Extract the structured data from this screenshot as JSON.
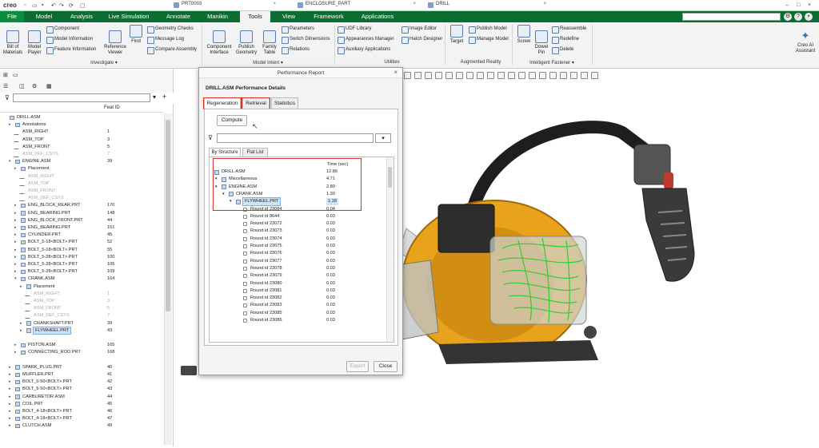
{
  "app": {
    "logo": "creo",
    "window_tabs": [
      "PRT0003",
      "ENCLOSURE_PART",
      "DRILL"
    ]
  },
  "ribbon": {
    "tabs": [
      "File",
      "Model",
      "Analysis",
      "Live Simulation",
      "Annotate",
      "Manikin",
      "Tools",
      "View",
      "Framework",
      "Applications"
    ],
    "active_tab": "Tools",
    "investigate": {
      "bill_of_materials": "Bill of\nMaterials",
      "model_player": "Model\nPlayer",
      "component": "Component",
      "model_information": "Model Information",
      "feature_information": "Feature Information",
      "reference_viewer": "Reference\nViewer",
      "find": "Find",
      "geometry_checks": "Geometry Checks",
      "message_log": "Message Log",
      "compare_assembly": "Compare Assembly",
      "group": "Investigate ▾"
    },
    "model_intent": {
      "component_interface": "Component\nInterface",
      "publish_geometry": "Publish\nGeometry",
      "family_table": "Family\nTable",
      "parameters": "Parameters",
      "switch_dimensions": "Switch Dimensions",
      "relations": "Relations",
      "group": "Model Intent ▾"
    },
    "utilities": {
      "udf_library": "UDF Library",
      "appearances_manager": "Appearances Manager",
      "auxiliary_applications": "Auxiliary Applications",
      "image_editor": "Image Editor",
      "hatch_designer": "Hatch Designer",
      "group": "Utilities"
    },
    "augmented_reality": {
      "target": "Target",
      "publish_model": "Publish Model",
      "manage_model": "Manage Model",
      "group": "Augmented Reality"
    },
    "intelligent_fastener": {
      "screw": "Screw",
      "dowel_pin": "Dowel\nPin",
      "reassemble": "Reassemble",
      "redefine": "Redefine",
      "delete": "Delete",
      "group": "Intelligent Fastener ▾"
    },
    "ai_assistant": "Creo AI\nAssistant"
  },
  "tree": {
    "feat_id_header": "Feat ID",
    "rows": [
      {
        "name": "DRILL.ASM",
        "id": "",
        "lvl": 0,
        "icon": "asm",
        "ex": ""
      },
      {
        "name": "Annotations",
        "id": "",
        "lvl": 1,
        "icon": "ann",
        "ex": "▸"
      },
      {
        "name": "ASM_RIGHT",
        "id": "1",
        "lvl": 1,
        "icon": "datum",
        "ex": ""
      },
      {
        "name": "ASM_TOP",
        "id": "3",
        "lvl": 1,
        "icon": "datum",
        "ex": ""
      },
      {
        "name": "ASM_FRONT",
        "id": "5",
        "lvl": 1,
        "icon": "datum",
        "ex": ""
      },
      {
        "name": "ASM_DEF_CSYS",
        "id": "7",
        "lvl": 1,
        "icon": "datum",
        "ex": "",
        "dim": true
      },
      {
        "name": "ENGINE.ASM",
        "id": "39",
        "lvl": 1,
        "icon": "asm",
        "ex": "▾"
      },
      {
        "name": "Placement",
        "id": "",
        "lvl": 2,
        "icon": "ann",
        "ex": "▸"
      },
      {
        "name": "ASM_RIGHT",
        "id": "",
        "lvl": 2,
        "icon": "datum",
        "ex": "",
        "dim": true
      },
      {
        "name": "ASM_TOP",
        "id": "",
        "lvl": 2,
        "icon": "datum",
        "ex": "",
        "dim": true
      },
      {
        "name": "ASM_FRONT",
        "id": "",
        "lvl": 2,
        "icon": "datum",
        "ex": "",
        "dim": true
      },
      {
        "name": "ASM_DEF_CSYS",
        "id": "",
        "lvl": 2,
        "icon": "datum",
        "ex": "",
        "dim": true
      },
      {
        "name": "ENG_BLOCK_REAR.PRT",
        "id": "170",
        "lvl": 2,
        "icon": "prt",
        "ex": "▸"
      },
      {
        "name": "ENG_BEARING.PRT",
        "id": "148",
        "lvl": 2,
        "icon": "prt",
        "ex": "▸"
      },
      {
        "name": "ENG_BLOCK_FRONT.PRT",
        "id": "44",
        "lvl": 2,
        "icon": "prt",
        "ex": "▸"
      },
      {
        "name": "ENG_BEARING.PRT",
        "id": "151",
        "lvl": 2,
        "icon": "prt",
        "ex": "▸"
      },
      {
        "name": "CYLINDER.PRT",
        "id": "45",
        "lvl": 2,
        "icon": "prt",
        "ex": "▸"
      },
      {
        "name": "BOLT_5-18<BOLT>.PRT",
        "id": "52",
        "lvl": 2,
        "icon": "prt",
        "ex": "▸"
      },
      {
        "name": "BOLT_5-18<BOLT>.PRT",
        "id": "55",
        "lvl": 2,
        "icon": "prt",
        "ex": "▸"
      },
      {
        "name": "BOLT_5-28<BOLT>.PRT",
        "id": "100",
        "lvl": 2,
        "icon": "prt",
        "ex": "▸"
      },
      {
        "name": "BOLT_5-28<BOLT>.PRT",
        "id": "105",
        "lvl": 2,
        "icon": "prt",
        "ex": "▸"
      },
      {
        "name": "BOLT_5-28<BOLT>.PRT",
        "id": "109",
        "lvl": 2,
        "icon": "prt",
        "ex": "▸"
      },
      {
        "name": "CRANK.ASM",
        "id": "164",
        "lvl": 2,
        "icon": "asm",
        "ex": "▾"
      },
      {
        "name": "Placement",
        "id": "",
        "lvl": 3,
        "icon": "ann",
        "ex": "▸"
      },
      {
        "name": "ASM_RIGHT",
        "id": "1",
        "lvl": 3,
        "icon": "datum",
        "ex": "",
        "dim": true
      },
      {
        "name": "ASM_TOP",
        "id": "3",
        "lvl": 3,
        "icon": "datum",
        "ex": "",
        "dim": true
      },
      {
        "name": "ASM_FRONT",
        "id": "5",
        "lvl": 3,
        "icon": "datum",
        "ex": "",
        "dim": true
      },
      {
        "name": "ASM_DEF_CSYS",
        "id": "7",
        "lvl": 3,
        "icon": "datum",
        "ex": "",
        "dim": true
      },
      {
        "name": "CRANKSHAFT.PRT",
        "id": "39",
        "lvl": 3,
        "icon": "prt",
        "ex": "▸"
      },
      {
        "name": "FLYWHEEL.PRT",
        "id": "43",
        "lvl": 3,
        "icon": "prt",
        "ex": "▸",
        "sel": true
      },
      {
        "name": "",
        "id": "",
        "lvl": 0,
        "icon": "none",
        "ex": ""
      },
      {
        "name": "PISTON.ASM",
        "id": "165",
        "lvl": 2,
        "icon": "asm",
        "ex": "▸"
      },
      {
        "name": "CONNECTING_ROD.PRT",
        "id": "168",
        "lvl": 2,
        "icon": "prt",
        "ex": "▸"
      },
      {
        "name": "",
        "id": "",
        "lvl": 0,
        "icon": "none",
        "ex": ""
      },
      {
        "name": "SPARK_PLUG.PRT",
        "id": "40",
        "lvl": 1,
        "icon": "prt",
        "ex": "▸"
      },
      {
        "name": "MUFFLER.PRT",
        "id": "41",
        "lvl": 1,
        "icon": "prt",
        "ex": "▸"
      },
      {
        "name": "BOLT_5-50<BOLT>.PRT",
        "id": "42",
        "lvl": 1,
        "icon": "prt",
        "ex": "▸"
      },
      {
        "name": "BOLT_5-50<BOLT>.PRT",
        "id": "43",
        "lvl": 1,
        "icon": "prt",
        "ex": "▸"
      },
      {
        "name": "CARBURETOR.ASM",
        "id": "44",
        "lvl": 1,
        "icon": "asm",
        "ex": "▸"
      },
      {
        "name": "COIL.PRT",
        "id": "45",
        "lvl": 1,
        "icon": "prt",
        "ex": "▸"
      },
      {
        "name": "BOLT_4-18<BOLT>.PRT",
        "id": "46",
        "lvl": 1,
        "icon": "prt",
        "ex": "▸"
      },
      {
        "name": "BOLT_4-18<BOLT>.PRT",
        "id": "47",
        "lvl": 1,
        "icon": "prt",
        "ex": "▸"
      },
      {
        "name": "CLUTCH.ASM",
        "id": "49",
        "lvl": 1,
        "icon": "asm",
        "ex": "▸"
      }
    ]
  },
  "dialog": {
    "title": "Performance Report",
    "subtitle": "DRILL.ASM Performance Details",
    "tabs": [
      "Regeneration",
      "Retrieval",
      "Statistics"
    ],
    "compute": "Compute",
    "subtabs": [
      "By Structure",
      "Flat List"
    ],
    "time_header": "Time (sec)",
    "rows": [
      {
        "name": "DRILL.ASM",
        "time": "12.86",
        "lvl": 0,
        "icon": "asm"
      },
      {
        "name": "Miscellaneous",
        "time": "4.71",
        "lvl": 1,
        "icon": "misc"
      },
      {
        "name": "ENGINE.ASM",
        "time": "2.80",
        "lvl": 1,
        "icon": "asm"
      },
      {
        "name": "CRANK.ASM",
        "time": "1.30",
        "lvl": 2,
        "icon": "asm"
      },
      {
        "name": "FLYWHEEL.PRT",
        "time": "1.18",
        "lvl": 3,
        "icon": "prt",
        "sel": true
      },
      {
        "name": "Round id 23084",
        "time": "0.04",
        "lvl": 4,
        "icon": "rnd"
      },
      {
        "name": "Round id 8644",
        "time": "0.03",
        "lvl": 4,
        "icon": "rnd"
      },
      {
        "name": "Round id 23072",
        "time": "0.03",
        "lvl": 4,
        "icon": "rnd"
      },
      {
        "name": "Round id 23073",
        "time": "0.03",
        "lvl": 4,
        "icon": "rnd"
      },
      {
        "name": "Round id 23074",
        "time": "0.03",
        "lvl": 4,
        "icon": "rnd"
      },
      {
        "name": "Round id 23075",
        "time": "0.03",
        "lvl": 4,
        "icon": "rnd"
      },
      {
        "name": "Round id 23076",
        "time": "0.03",
        "lvl": 4,
        "icon": "rnd"
      },
      {
        "name": "Round id 23077",
        "time": "0.03",
        "lvl": 4,
        "icon": "rnd"
      },
      {
        "name": "Round id 23078",
        "time": "0.03",
        "lvl": 4,
        "icon": "rnd"
      },
      {
        "name": "Round id 23079",
        "time": "0.03",
        "lvl": 4,
        "icon": "rnd"
      },
      {
        "name": "Round id 23080",
        "time": "0.03",
        "lvl": 4,
        "icon": "rnd"
      },
      {
        "name": "Round id 23081",
        "time": "0.03",
        "lvl": 4,
        "icon": "rnd"
      },
      {
        "name": "Round id 23082",
        "time": "0.03",
        "lvl": 4,
        "icon": "rnd"
      },
      {
        "name": "Round id 23083",
        "time": "0.03",
        "lvl": 4,
        "icon": "rnd"
      },
      {
        "name": "Round id 23085",
        "time": "0.03",
        "lvl": 4,
        "icon": "rnd"
      },
      {
        "name": "Round id 23086",
        "time": "0.03",
        "lvl": 4,
        "icon": "rnd"
      }
    ],
    "export": "Export",
    "close": "Close"
  },
  "colors": {
    "ribbon_green": "#0a6e33",
    "file_tab": "#0a8c3e",
    "highlight_red": "#d9322b",
    "selection": "#cfe3f7",
    "drill_orange": "#e8a21c"
  }
}
